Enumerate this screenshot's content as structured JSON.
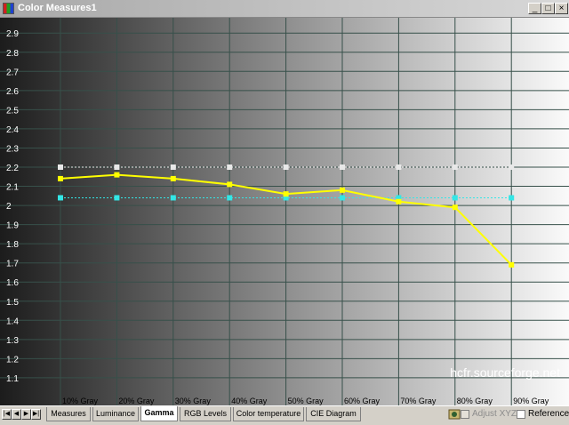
{
  "window": {
    "title": "Color Measures1"
  },
  "title_buttons": [
    "_",
    "□",
    "×"
  ],
  "chart_data": {
    "type": "line",
    "categories": [
      "10% Gray",
      "20% Gray",
      "30% Gray",
      "40% Gray",
      "50% Gray",
      "60% Gray",
      "70% Gray",
      "80% Gray",
      "90% Gray"
    ],
    "y_ticks": [
      "2.9",
      "2.8",
      "2.7",
      "2.6",
      "2.5",
      "2.4",
      "2.3",
      "2.2",
      "2.1",
      "2",
      "1.9",
      "1.8",
      "1.7",
      "1.6",
      "1.5",
      "1.4",
      "1.3",
      "1.2",
      "1.1"
    ],
    "ylim": [
      1.03,
      2.98
    ],
    "series": [
      {
        "values": [
          2.14,
          2.16,
          2.14,
          2.11,
          2.06,
          2.08,
          2.02,
          1.99,
          1.69
        ],
        "color": "#ffff00",
        "style": "solid"
      },
      {
        "values": [
          2.2,
          2.2,
          2.2,
          2.2,
          2.2,
          2.2,
          2.2,
          2.2,
          2.2
        ],
        "color": "#e8e8e8",
        "style": "dotted"
      },
      {
        "values": [
          2.04,
          2.04,
          2.04,
          2.04,
          2.04,
          2.04,
          2.04,
          2.04,
          2.04
        ],
        "color": "#33e6e6",
        "style": "dotted"
      }
    ],
    "watermark": "hcfr.sourceforge.net",
    "grid": true,
    "background": "gray-ramp dark-to-light"
  },
  "tabs": [
    {
      "label": "Measures",
      "active": false
    },
    {
      "label": "Luminance",
      "active": false
    },
    {
      "label": "Gamma",
      "active": true
    },
    {
      "label": "RGB Levels",
      "active": false
    },
    {
      "label": "Color temperature",
      "active": false
    },
    {
      "label": "CIE Diagram",
      "active": false
    }
  ],
  "nav_buttons": [
    "|◀",
    "◀",
    "▶",
    "▶|"
  ],
  "options": {
    "adjust_xyz": {
      "label": "Adjust XYZ",
      "checked": false,
      "enabled": false
    },
    "reference": {
      "label": "Reference",
      "checked": false,
      "enabled": true
    }
  }
}
